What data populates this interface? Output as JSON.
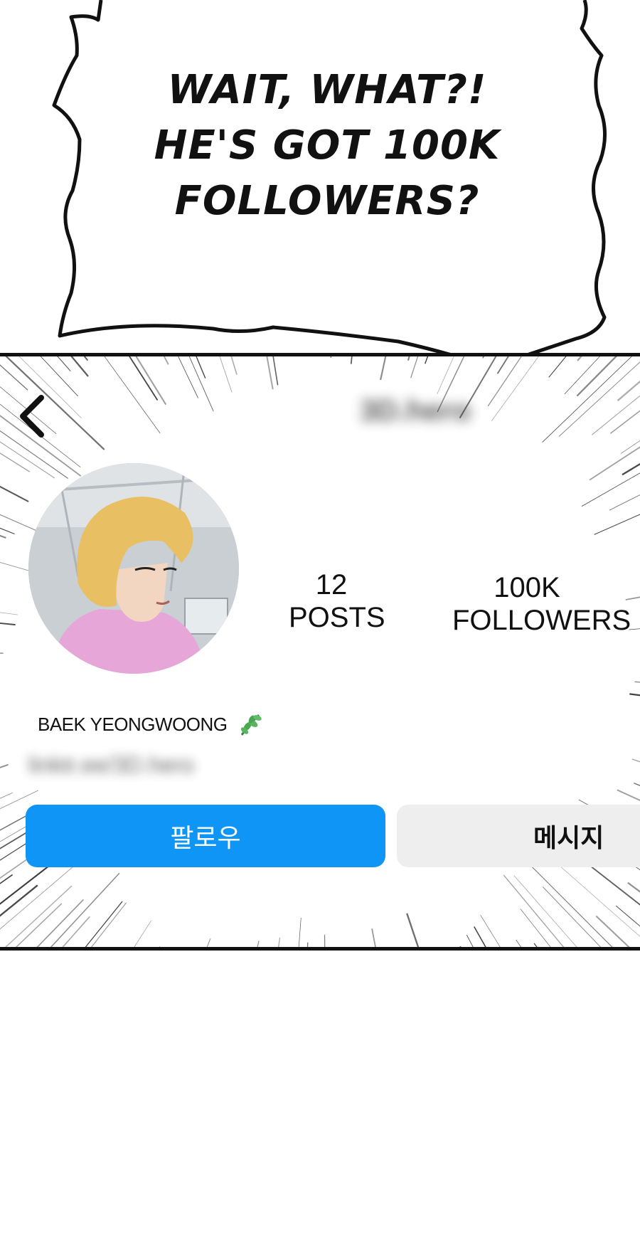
{
  "speech_bubble": {
    "lines": [
      "WAIT, WHAT?!",
      "HE'S GOT 100K",
      "FOLLOWERS?"
    ]
  },
  "profile": {
    "handle": "3D.hero",
    "stats": {
      "posts": {
        "value": "12",
        "label": "POSTS"
      },
      "followers": {
        "value": "100K",
        "label": "FOLLOWERS"
      }
    },
    "name": "BAEK YEONGWOONG",
    "link": "linktr.ee/3D.hero",
    "buttons": {
      "follow": "팔로우",
      "message": "메시지"
    }
  },
  "colors": {
    "follow_button": "#0f95f6",
    "message_button": "#eeeeef",
    "panel_border": "#111111"
  },
  "icons": {
    "back": "chevron-left-icon",
    "badge": "herb-icon"
  }
}
